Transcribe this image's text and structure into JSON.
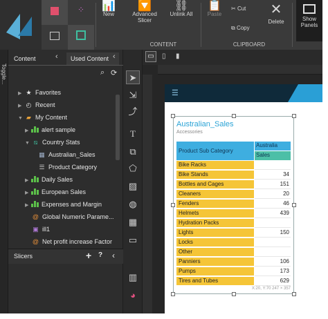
{
  "ribbon": {
    "new_label": "New",
    "advanced_slicer_label": "Advanced Slicer",
    "unlink_all_label": "Unlink All",
    "paste_label": "Paste",
    "cut_label": "Cut",
    "copy_label": "Copy",
    "delete_label": "Delete",
    "show_panels_label": "Show Panels",
    "content_group": "CONTENT",
    "clipboard_group": "CLIPBOARD"
  },
  "explore_strip": {
    "label": "Toggle..."
  },
  "tabs": {
    "content": "Content",
    "used_content": "Used Content"
  },
  "tree": {
    "favorites": "Favorites",
    "recent": "Recent",
    "my_content": "My Content",
    "alert_sample": "alert sample",
    "country_stats": "Country Stats",
    "australian_sales": "Australian_Sales",
    "product_category": "Product Category",
    "daily_sales": "Daily Sales",
    "european_sales": "European Sales",
    "expenses_margin": "Expenses and Margin",
    "global_numeric": "Global Numeric Parame...",
    "ill1": "ill1",
    "net_profit": "Net profit increase Factor"
  },
  "slicers": {
    "label": "Slicers",
    "add": "+",
    "help": "?",
    "more": "‹"
  },
  "widget": {
    "title": "Australian_Sales",
    "subtitle": "Accessories",
    "header_dim": "Product Sub Category",
    "header_col1": "Australia",
    "header_col2": "Sales",
    "rows": [
      {
        "name": "Bike Racks",
        "value": ""
      },
      {
        "name": "Bike Stands",
        "value": "34"
      },
      {
        "name": "Bottles and Cages",
        "value": "151"
      },
      {
        "name": "Cleaners",
        "value": "20"
      },
      {
        "name": "Fenders",
        "value": "46"
      },
      {
        "name": "Helmets",
        "value": "439"
      },
      {
        "name": "Hydration Packs",
        "value": ""
      },
      {
        "name": "Lights",
        "value": "150"
      },
      {
        "name": "Locks",
        "value": ""
      },
      {
        "name": "Other",
        "value": ""
      },
      {
        "name": "Panniers",
        "value": "106"
      },
      {
        "name": "Pumps",
        "value": "173"
      },
      {
        "name": "Tires and Tubes",
        "value": "629"
      }
    ],
    "coord_readout": "X:20, Y:70 247 × 357"
  },
  "colors": {
    "accent_blue": "#3eaee0",
    "accent_teal": "#4cbfa7",
    "row_yellow": "#f5c537",
    "bars_green": "#5cc14a",
    "title_blue": "#29a3d6"
  }
}
